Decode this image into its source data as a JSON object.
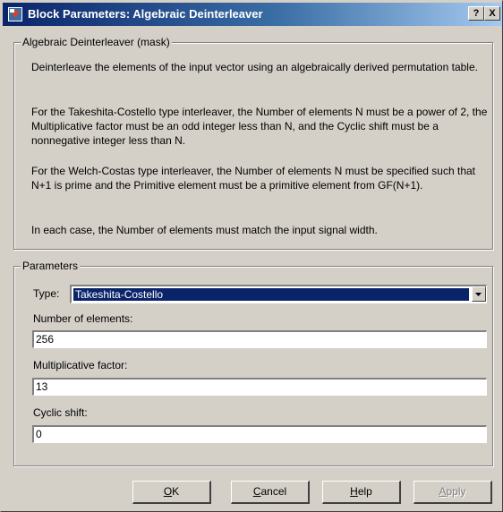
{
  "window": {
    "title": "Block Parameters: Algebraic Deinterleaver",
    "help_glyph": "?",
    "close_glyph": "X"
  },
  "mask": {
    "legend": "Algebraic Deinterleaver (mask)",
    "paragraphs": [
      "Deinterleave the elements of the input vector using an algebraically derived permutation table.",
      "For the Takeshita-Costello type interleaver, the Number of elements N must be a power of 2, the Multiplicative factor must be an odd integer less than N, and the Cyclic shift must be a nonnegative integer less than N.",
      "For the Welch-Costas type interleaver, the Number of elements N must be specified such that N+1 is prime and the Primitive element must be a primitive element from GF(N+1).",
      "In each case, the Number of elements must match the input signal width."
    ]
  },
  "parameters": {
    "legend": "Parameters",
    "type_label": "Type:",
    "type_value": "Takeshita-Costello",
    "num_elements_label": "Number of elements:",
    "num_elements_value": "256",
    "mult_factor_label": "Multiplicative factor:",
    "mult_factor_value": "13",
    "cyclic_shift_label": "Cyclic shift:",
    "cyclic_shift_value": "0"
  },
  "buttons": {
    "ok_mnemonic": "O",
    "ok_rest": "K",
    "cancel_mnemonic": "C",
    "cancel_rest": "ancel",
    "help_mnemonic": "H",
    "help_rest": "elp",
    "apply_mnemonic": "A",
    "apply_rest": "pply"
  },
  "icons": {
    "app": "simulink-block-icon",
    "dropdown": "chevron-down-icon"
  }
}
